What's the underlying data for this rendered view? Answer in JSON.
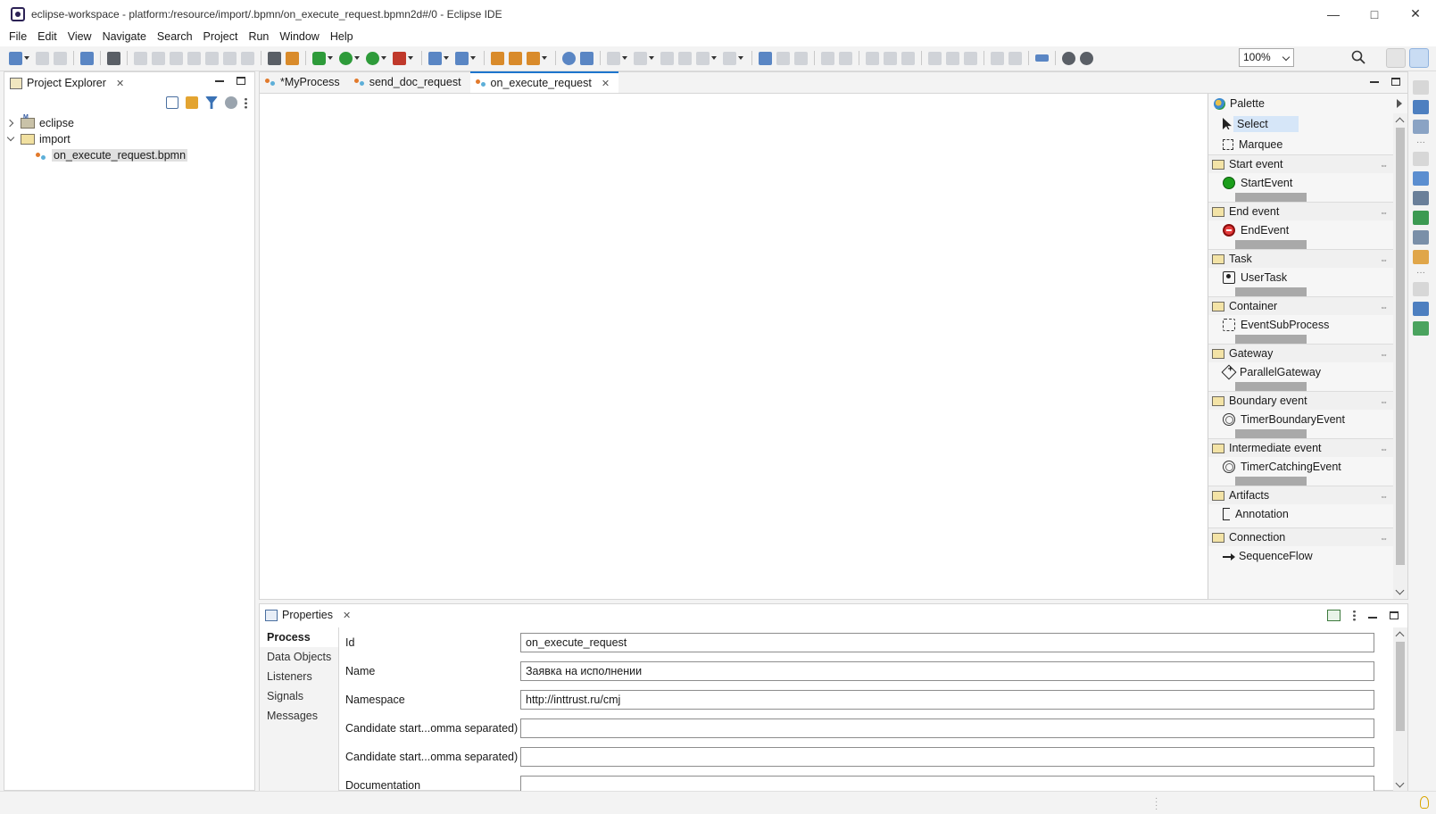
{
  "window": {
    "title": "eclipse-workspace - platform:/resource/import/.bpmn/on_execute_request.bpmn2d#/0 - Eclipse IDE"
  },
  "menu": [
    "File",
    "Edit",
    "View",
    "Navigate",
    "Search",
    "Project",
    "Run",
    "Window",
    "Help"
  ],
  "toolbar": {
    "zoom": "100%"
  },
  "project_explorer": {
    "title": "Project Explorer",
    "tree": [
      {
        "label": "eclipse",
        "expanded": false
      },
      {
        "label": "import",
        "expanded": true
      },
      {
        "label": "on_execute_request.bpmn",
        "selected": true
      }
    ]
  },
  "editor": {
    "tabs": [
      {
        "label": "*MyProcess",
        "active": false
      },
      {
        "label": "send_doc_request",
        "active": false
      },
      {
        "label": "on_execute_request",
        "active": true
      }
    ]
  },
  "palette": {
    "title": "Palette",
    "tools": [
      "Select",
      "Marquee"
    ],
    "drawers": [
      {
        "name": "Start event",
        "item": "StartEvent",
        "icon": "start-event-icon"
      },
      {
        "name": "End event",
        "item": "EndEvent",
        "icon": "end-event-icon"
      },
      {
        "name": "Task",
        "item": "UserTask",
        "icon": "user-task-icon"
      },
      {
        "name": "Container",
        "item": "EventSubProcess",
        "icon": "subprocess-icon"
      },
      {
        "name": "Gateway",
        "item": "ParallelGateway",
        "icon": "gateway-icon"
      },
      {
        "name": "Boundary event",
        "item": "TimerBoundaryEvent",
        "icon": "timer-icon"
      },
      {
        "name": "Intermediate event",
        "item": "TimerCatchingEvent",
        "icon": "timer-icon"
      },
      {
        "name": "Artifacts",
        "item": "Annotation",
        "icon": "annotation-icon"
      },
      {
        "name": "Connection",
        "item": "SequenceFlow",
        "icon": "sequence-flow-icon"
      }
    ]
  },
  "properties": {
    "title": "Properties",
    "nav": [
      "Process",
      "Data Objects",
      "Listeners",
      "Signals",
      "Messages"
    ],
    "fields": [
      {
        "label": "Id",
        "value": "on_execute_request"
      },
      {
        "label": "Name",
        "value": "Заявка на исполнении"
      },
      {
        "label": "Namespace",
        "value": "http://inttrust.ru/cmj"
      },
      {
        "label": "Candidate start...omma separated)",
        "value": ""
      },
      {
        "label": "Candidate start...omma separated)",
        "value": ""
      },
      {
        "label": "Documentation",
        "value": ""
      }
    ]
  }
}
